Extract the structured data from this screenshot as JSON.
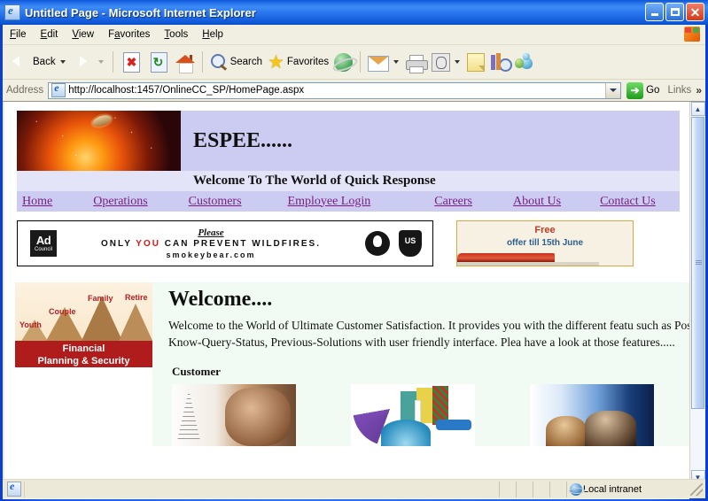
{
  "browser": {
    "title": "Untitled Page - Microsoft Internet Explorer",
    "title_icon": "ie-page-icon",
    "window_buttons": {
      "minimize": "minimize-button",
      "maximize": "maximize-button",
      "close": "close-button"
    },
    "menus": [
      {
        "label": "File",
        "accel": "F"
      },
      {
        "label": "Edit",
        "accel": "E"
      },
      {
        "label": "View",
        "accel": "V"
      },
      {
        "label": "Favorites",
        "accel": "a"
      },
      {
        "label": "Tools",
        "accel": "T"
      },
      {
        "label": "Help",
        "accel": "H"
      }
    ],
    "toolbar": {
      "back_label": "Back",
      "forward_label": "",
      "stop_icon": "stop-icon",
      "refresh_icon": "refresh-icon",
      "home_icon": "home-icon",
      "search_label": "Search",
      "favorites_label": "Favorites",
      "history_icon": "history-icon",
      "mail_icon": "mail-icon",
      "print_icon": "print-icon",
      "edit_icon": "edit-icon",
      "notes_icon": "notes-icon",
      "research_icon": "research-icon",
      "messenger_icon": "messenger-icon"
    },
    "address": {
      "label": "Address",
      "value": "http://localhost:1457/OnlineCC_SP/HomePage.aspx",
      "placeholder": "",
      "go_label": "Go",
      "links_label": "Links",
      "overflow_chevron": "»"
    },
    "status": {
      "zone": "Local intranet",
      "zone_icon": "intranet-globe-icon"
    }
  },
  "site": {
    "brand": "ESPEE......",
    "tagline": "Welcome To The World of Quick Response",
    "banner_image": "space-planet-banner-image",
    "nav": [
      "Home",
      "Operations",
      "Customers",
      "Employee Login",
      "Careers",
      "About Us",
      "Contact Us"
    ],
    "ad_banner": {
      "sponsor_line1": "Ad",
      "sponsor_line2": "Council",
      "please": "Please",
      "headline_pre": "ONLY ",
      "headline_you": "YOU",
      "headline_post": " CAN PREVENT WILDFIRES.",
      "website": "smokeybear.com",
      "seal_icon": "smokey-bear-seal-icon",
      "shield_icon": "us-forest-service-shield-icon"
    },
    "promo": {
      "title": "Free",
      "subtitle": "offer till 15th June",
      "image": "red-train-image"
    },
    "side_promo": {
      "labels": [
        "Youth",
        "Couple",
        "Family",
        "Retire"
      ],
      "caption_line1": "Financial",
      "caption_line2": "Planning & Security",
      "image": "mountains-financial-image"
    },
    "main": {
      "heading": "Welcome....",
      "paragraph": "Welcome to the World of Ultimate Customer Satisfaction. It provides you with the different featu such as Post-a-Query, Know-Query-Status, Previous-Solutions with user friendly interface. Plea have a look at those features.....",
      "section_heading": "Customer",
      "thumbnails": [
        "elderly-man-tower-image",
        "colorful-globe-people-image",
        "people-earth-horizon-image"
      ]
    }
  }
}
